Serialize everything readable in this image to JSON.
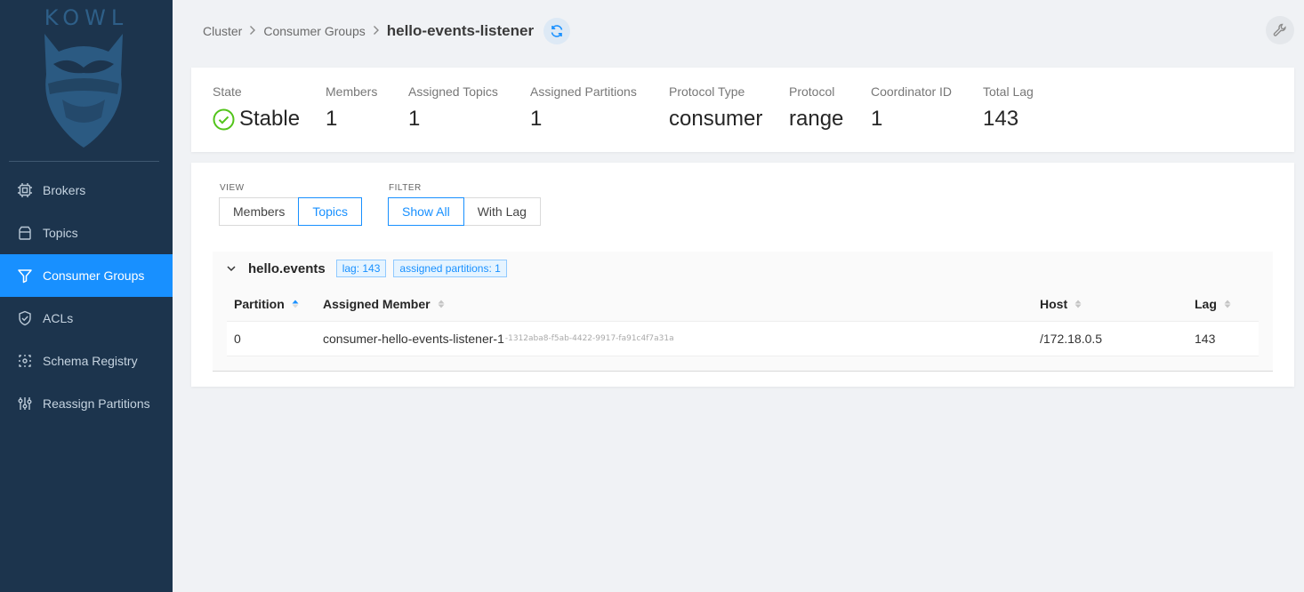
{
  "app": {
    "logo_text": "KOWL"
  },
  "sidebar": {
    "items": [
      {
        "label": "Brokers",
        "icon": "cpu-icon",
        "active": false
      },
      {
        "label": "Topics",
        "icon": "database-icon",
        "active": false
      },
      {
        "label": "Consumer Groups",
        "icon": "funnel-icon",
        "active": true
      },
      {
        "label": "ACLs",
        "icon": "shield-icon",
        "active": false
      },
      {
        "label": "Schema Registry",
        "icon": "schema-icon",
        "active": false
      },
      {
        "label": "Reassign Partitions",
        "icon": "sliders-icon",
        "active": false
      }
    ]
  },
  "breadcrumb": {
    "items": [
      "Cluster",
      "Consumer Groups"
    ],
    "current": "hello-events-listener"
  },
  "stats": [
    {
      "label": "State",
      "value": "Stable"
    },
    {
      "label": "Members",
      "value": "1"
    },
    {
      "label": "Assigned Topics",
      "value": "1"
    },
    {
      "label": "Assigned Partitions",
      "value": "1"
    },
    {
      "label": "Protocol Type",
      "value": "consumer"
    },
    {
      "label": "Protocol",
      "value": "range"
    },
    {
      "label": "Coordinator ID",
      "value": "1"
    },
    {
      "label": "Total Lag",
      "value": "143"
    }
  ],
  "view": {
    "label": "VIEW",
    "options": [
      "Members",
      "Topics"
    ],
    "selected": "Topics"
  },
  "filter": {
    "label": "FILTER",
    "options": [
      "Show All",
      "With Lag"
    ],
    "selected": "Show All"
  },
  "topic": {
    "name": "hello.events",
    "lag_tag": "lag: 143",
    "partitions_tag": "assigned partitions: 1",
    "columns": [
      "Partition",
      "Assigned Member",
      "Host",
      "Lag"
    ],
    "rows": [
      {
        "partition": "0",
        "member": "consumer-hello-events-listener-1",
        "member_id": "-1312aba8-f5ab-4422-9917-fa91c4f7a31a",
        "host": "/172.18.0.5",
        "lag": "143"
      }
    ]
  },
  "colors": {
    "sidebar_bg": "#1c344d",
    "accent": "#1890ff",
    "stable_green": "#52c41a"
  }
}
